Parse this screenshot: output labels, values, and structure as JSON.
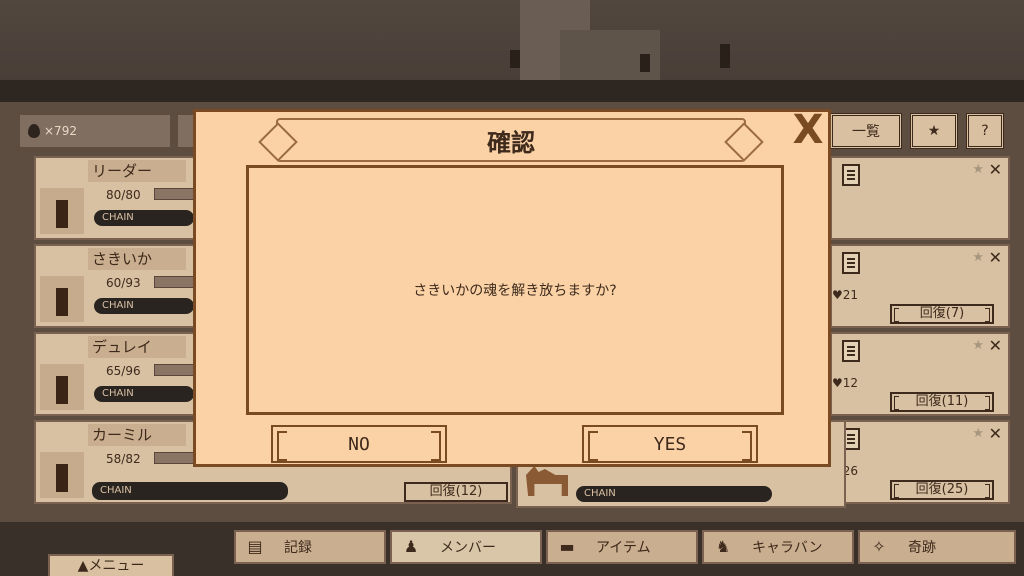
{
  "resources": {
    "soul_count": "×792"
  },
  "header": {
    "list_button": "一覧",
    "favorite_icon": "★",
    "help_icon": "?"
  },
  "members": [
    {
      "name": "リーダー",
      "hp": "80/80",
      "chain": "CHAIN"
    },
    {
      "name": "さきいか",
      "hp": "60/93",
      "chain": "CHAIN"
    },
    {
      "name": "デュレイ",
      "hp": "65/96",
      "chain": "CHAIN"
    },
    {
      "name": "カーミル",
      "hp": "58/82",
      "chain": "CHAIN",
      "heal": "回復(12)"
    }
  ],
  "right_cards": [
    {
      "heart": "",
      "heal": ""
    },
    {
      "heart": "♥21",
      "heal": "回復(7)"
    },
    {
      "heart": "♥12",
      "heal": "回復(11)"
    },
    {
      "heart": "♥26",
      "heal": "回復(25)"
    }
  ],
  "bottom_card": {
    "chain": "CHAIN"
  },
  "dialog": {
    "title": "確認",
    "message": "さきいかの魂を解き放ちますか?",
    "no_label": "NO",
    "yes_label": "YES",
    "close_icon": "X"
  },
  "tabs": [
    {
      "label": "記録",
      "icon": "document-icon"
    },
    {
      "label": "メンバー",
      "icon": "members-icon"
    },
    {
      "label": "アイテム",
      "icon": "chest-icon"
    },
    {
      "label": "キャラバン",
      "icon": "camel-icon"
    },
    {
      "label": "奇跡",
      "icon": "sparkle-icon"
    }
  ],
  "menu_button": "▲メニュー"
}
